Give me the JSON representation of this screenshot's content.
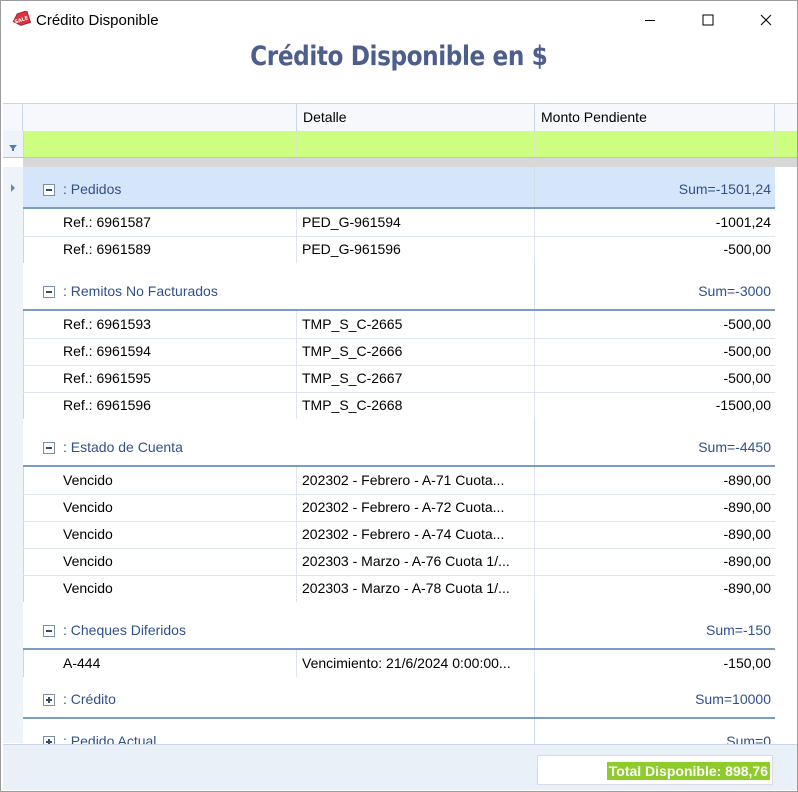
{
  "window": {
    "title": "Crédito Disponible"
  },
  "heading": "Crédito Disponible en  $",
  "columns": [
    "",
    "Detalle",
    "Monto Pendiente"
  ],
  "groups": [
    {
      "label": ": Pedidos",
      "sum": "Sum=-1501,24",
      "expanded": true,
      "rows": [
        {
          "ref": "Ref.: 6961587",
          "detail": "PED_G-961594",
          "amount": "-1001,24"
        },
        {
          "ref": "Ref.: 6961589",
          "detail": "PED_G-961596",
          "amount": "-500,00"
        }
      ]
    },
    {
      "label": ": Remitos No Facturados",
      "sum": "Sum=-3000",
      "expanded": true,
      "rows": [
        {
          "ref": "Ref.: 6961593",
          "detail": "TMP_S_C-2665",
          "amount": "-500,00"
        },
        {
          "ref": "Ref.: 6961594",
          "detail": "TMP_S_C-2666",
          "amount": "-500,00"
        },
        {
          "ref": "Ref.: 6961595",
          "detail": "TMP_S_C-2667",
          "amount": "-500,00"
        },
        {
          "ref": "Ref.: 6961596",
          "detail": "TMP_S_C-2668",
          "amount": "-1500,00"
        }
      ]
    },
    {
      "label": ": Estado de Cuenta",
      "sum": "Sum=-4450",
      "expanded": true,
      "rows": [
        {
          "ref": "Vencido",
          "detail": "202302 - Febrero - A-71 Cuota...",
          "amount": "-890,00"
        },
        {
          "ref": "Vencido",
          "detail": "202302 - Febrero - A-72 Cuota...",
          "amount": "-890,00"
        },
        {
          "ref": "Vencido",
          "detail": "202302 - Febrero - A-74 Cuota...",
          "amount": "-890,00"
        },
        {
          "ref": "Vencido",
          "detail": "202303 - Marzo - A-76 Cuota 1/...",
          "amount": "-890,00"
        },
        {
          "ref": "Vencido",
          "detail": "202303 - Marzo - A-78 Cuota 1/...",
          "amount": "-890,00"
        }
      ]
    },
    {
      "label": ": Cheques Diferidos",
      "sum": "Sum=-150",
      "expanded": true,
      "rows": [
        {
          "ref": "A-444",
          "detail": "Vencimiento: 21/6/2024 0:00:00...",
          "amount": "-150,00"
        }
      ]
    },
    {
      "label": ": Crédito",
      "sum": "Sum=10000",
      "expanded": false,
      "rows": []
    },
    {
      "label": ": Pedido Actual",
      "sum": "Sum=0",
      "expanded": false,
      "rows": []
    }
  ],
  "footer": {
    "total": "Total Disponible: 898,76"
  },
  "colors": {
    "heading": "#4d5d8d",
    "filter_row": "#ccff80",
    "group_text": "#30508a",
    "total_bg": "#8ecc2c"
  }
}
